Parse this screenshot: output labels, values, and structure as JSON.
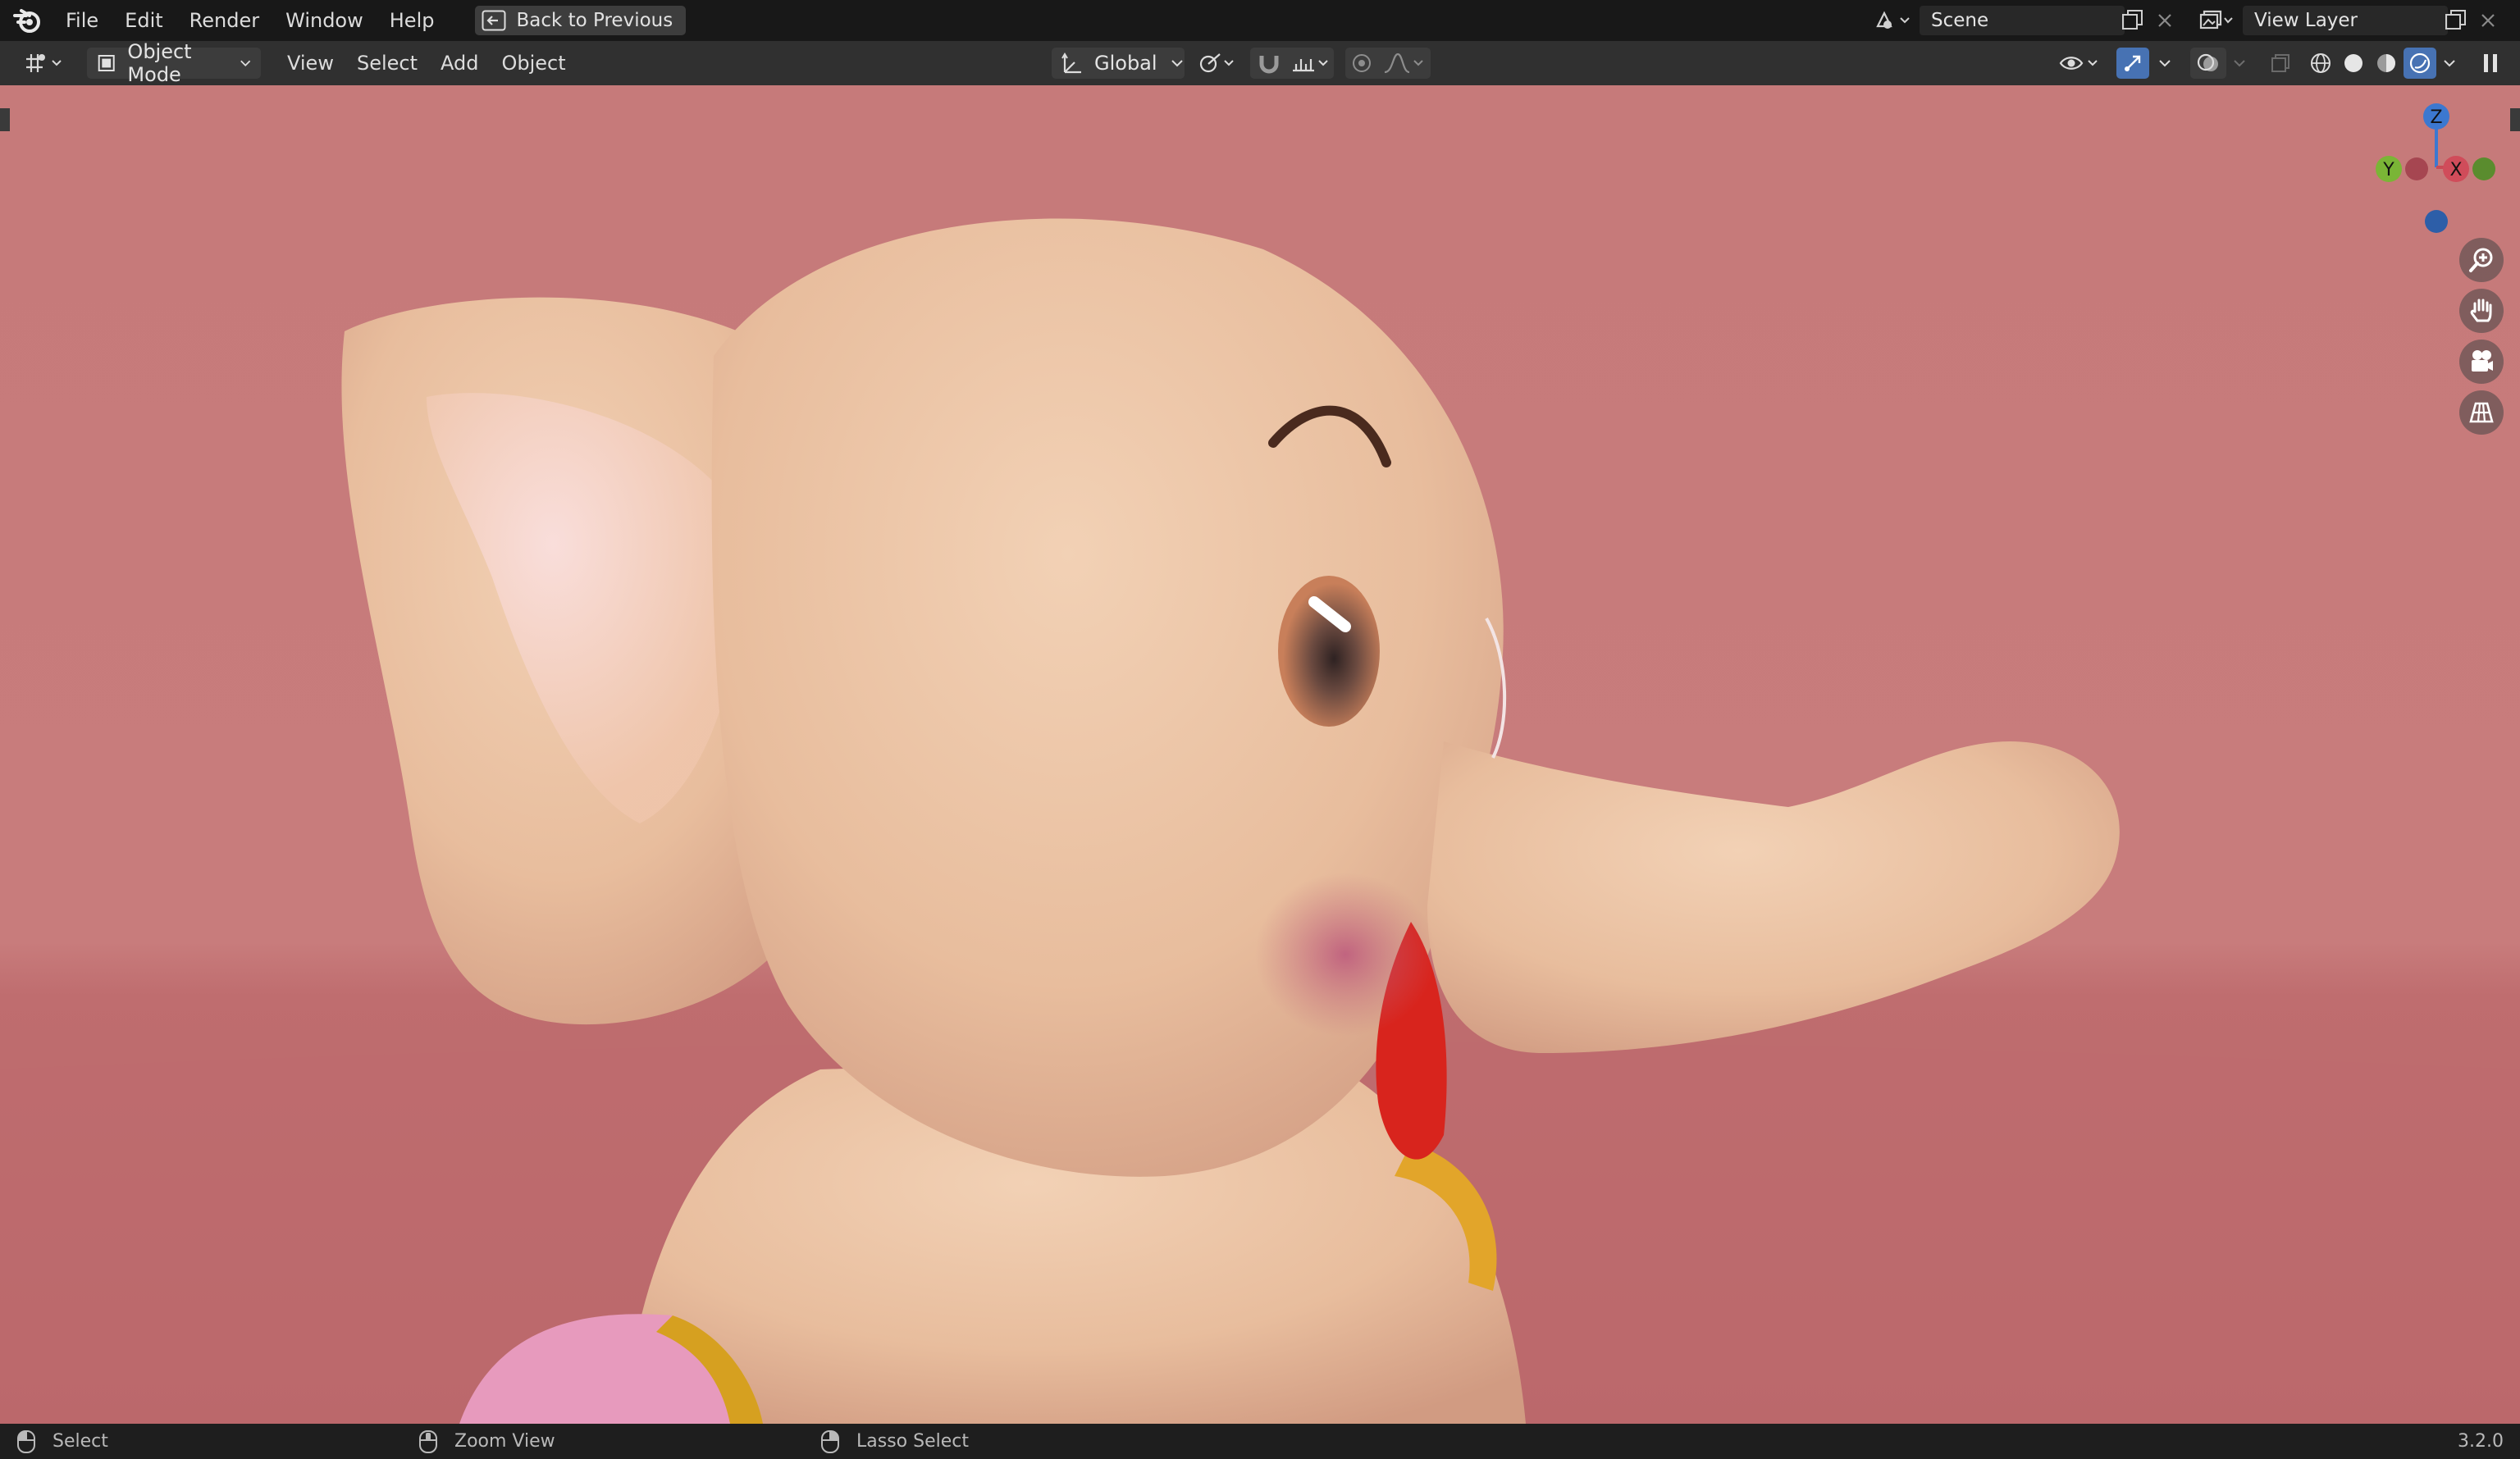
{
  "menu": {
    "items": [
      "File",
      "Edit",
      "Render",
      "Window",
      "Help"
    ],
    "back_button": "Back to Previous"
  },
  "scene_field": "Scene",
  "view_layer_field": "View Layer",
  "header": {
    "mode": "Object Mode",
    "menus": [
      "View",
      "Select",
      "Add",
      "Object"
    ],
    "transform_orientation": "Global"
  },
  "navigation_gizmo": {
    "axes": [
      "Z",
      "Y",
      "X"
    ]
  },
  "viewport": {
    "background_color": "#c67a7a",
    "floor_color": "#b96567",
    "shading": "rendered",
    "subject": "elephant character model"
  },
  "icons": {
    "logo": "blender-logo-icon",
    "back": "back-arrow-icon",
    "scene": "scene-icon",
    "view_layer": "view-layer-icon",
    "editor": "editor-type-icon",
    "zoom": "zoom-icon",
    "pan": "hand-pan-icon",
    "camera": "camera-view-icon",
    "grid": "grid-view-icon"
  },
  "statusbar": {
    "left": "Select",
    "middle": "Zoom View",
    "right_hint": "Lasso Select",
    "version": "3.2.0"
  }
}
